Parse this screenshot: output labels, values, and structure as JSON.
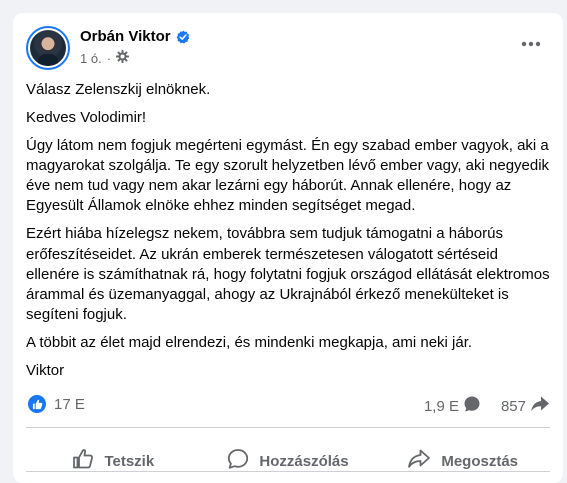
{
  "post": {
    "author": "Orbán Viktor",
    "time": "1 ó.",
    "separator": "·",
    "paragraphs": [
      "Válasz Zelenszkij elnöknek.",
      "Kedves Volodimir!",
      "Úgy látom nem fogjuk megérteni egymást. Én egy szabad ember vagyok, aki a magyarokat szolgálja. Te egy szorult helyzetben lévő ember vagy, aki negyedik éve nem tud vagy nem akar lezárni egy háborút. Annak ellenére, hogy az Egyesült Államok elnöke ehhez minden segítséget megad.",
      "Ezért hiába hízelegsz nekem, továbbra sem tudjuk támogatni a háborús erőfeszítéseidet. Az ukrán emberek természetesen válogatott sértéseid ellenére is számíthatnak rá, hogy folytatni fogjuk országod ellátását elektromos árammal és üzemanyaggal, ahogy az Ukrajnából érkező menekülteket is segíteni fogjuk.",
      "A többit az élet majd elrendezi, és mindenki megkapja, ami neki jár.",
      "Viktor"
    ]
  },
  "stats": {
    "reactions": "17 E",
    "comments": "1,9 E",
    "shares": "857"
  },
  "actions": {
    "like": "Tetszik",
    "comment": "Hozzászólás",
    "share": "Megosztás"
  },
  "colors": {
    "accent": "#1877f2",
    "secondary_text": "#65676b",
    "background": "#f0f2f5"
  },
  "icons": [
    "verified-badge-icon",
    "globe-settings-icon",
    "more-options-icon",
    "like-reaction-icon",
    "comment-icon",
    "share-icon",
    "thumbs-up-icon",
    "speech-bubble-icon",
    "share-arrow-icon"
  ]
}
